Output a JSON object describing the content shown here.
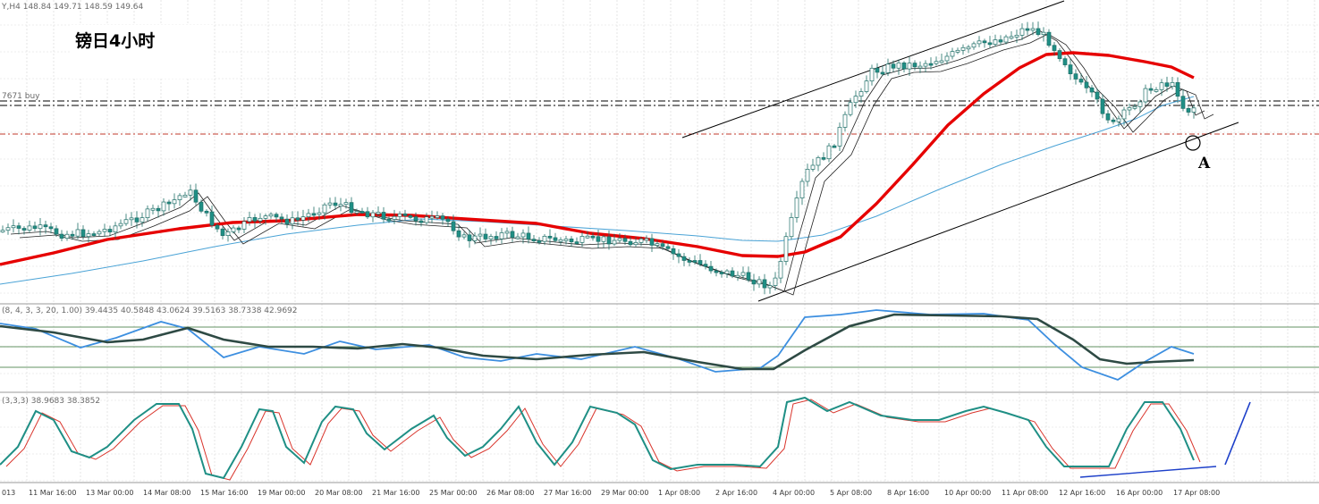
{
  "chart_data": {
    "type": "candlestick",
    "title": "镑日4小时",
    "symbol_header": "Y,H4  148.84 149.71 148.59 149.64",
    "price_line_label": "7671 buy",
    "panel2_header": "(8, 4, 3, 3, 20, 1.00) 39.4435 40.5848 43.0624 39.5163 38.7338 42.9692",
    "panel3_header": "(3,3,3) 38.9683 38.3852",
    "annotation_label": "A",
    "x_ticks": [
      "013",
      "11 Mar 16:00",
      "13 Mar 00:00",
      "14 Mar 08:00",
      "15 Mar 16:00",
      "19 Mar 00:00",
      "20 Mar 08:00",
      "21 Mar 16:00",
      "25 Mar 00:00",
      "26 Mar 08:00",
      "27 Mar 16:00",
      "29 Mar 00:00",
      "1 Apr 08:00",
      "2 Apr 16:00",
      "4 Apr 00:00",
      "5 Apr 08:00",
      "8 Apr 16:00",
      "10 Apr 00:00",
      "11 Apr 08:00",
      "12 Apr 16:00",
      "16 Apr 00:00",
      "17 Apr 08:00"
    ],
    "grid": true,
    "colors": {
      "up_candle": "#ffffff",
      "down_candle": "#1f8f85",
      "ma_slow": "#e60000",
      "ma_mid": "#4aa3d6",
      "ma_fast": "#222222",
      "channel": "#000000",
      "support_line": "#c0392b",
      "stoch_main": "#1f8f85",
      "stoch_signal": "#d9342b",
      "osc_fast": "#3d8fe0",
      "osc_slow": "#2e4a44",
      "divergence": "#1c3fc9"
    }
  }
}
